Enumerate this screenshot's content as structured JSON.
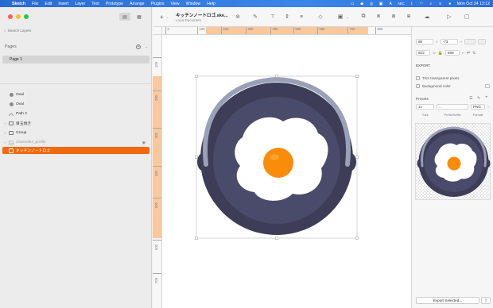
{
  "menubar": {
    "app_name": "Sketch",
    "items": [
      "File",
      "Edit",
      "Insert",
      "Layer",
      "Text",
      "Prototype",
      "Arrange",
      "Plugins",
      "View",
      "Window",
      "Help"
    ],
    "input_source": "ABC",
    "clock": "Mon Oct 24  13:12"
  },
  "sidebar": {
    "search_placeholder": "Search Layers",
    "pages_title": "Pages",
    "pages": [
      "Page 1"
    ],
    "layers": [
      {
        "name": "Oval",
        "icon": "oval-icon",
        "expandable": false
      },
      {
        "name": "Oval",
        "icon": "oval-icon",
        "expandable": false
      },
      {
        "name": "Path 2",
        "icon": "path-icon",
        "expandable": false
      },
      {
        "name": "目玉焼き",
        "icon": "folder-icon",
        "expandable": true
      },
      {
        "name": "Group",
        "icon": "folder-icon",
        "expandable": true
      },
      {
        "name": "channels4_profile",
        "icon": "image-icon",
        "expandable": true,
        "hidden": true
      },
      {
        "name": "キッチンノートロゴ",
        "icon": "artboard-icon",
        "expandable": false,
        "selected": true
      }
    ]
  },
  "toolbar": {
    "doc_title": "キッチンノートロゴ.ske...",
    "doc_subtitle": "Local Document"
  },
  "rulers": {
    "horizontal": [
      "0",
      "100",
      "200",
      "300",
      "400",
      "500",
      "600",
      "700",
      "800"
    ],
    "vertical": [
      "100",
      "200",
      "300",
      "400",
      "500",
      "600",
      "700"
    ]
  },
  "inspector": {
    "x": "88",
    "y": "-73",
    "w": "603",
    "h": "606",
    "export_title": "EXPORT",
    "trim_label": "Trim transparent pixels",
    "bg_label": "Background color",
    "presets_title": "Presets",
    "size_value": "1x",
    "prefix_value": "...",
    "format_value": "PNG",
    "size_label": "Size",
    "prefix_label": "Prefix/Suffix",
    "format_label": "Format",
    "export_button": "Export Selected..."
  },
  "colors": {
    "accent": "#f06a0f",
    "pan_dark": "#3d3d57",
    "pan_inner": "#4a4a6a",
    "handle": "#9aa0b8",
    "yolk": "#fa8c0c"
  }
}
